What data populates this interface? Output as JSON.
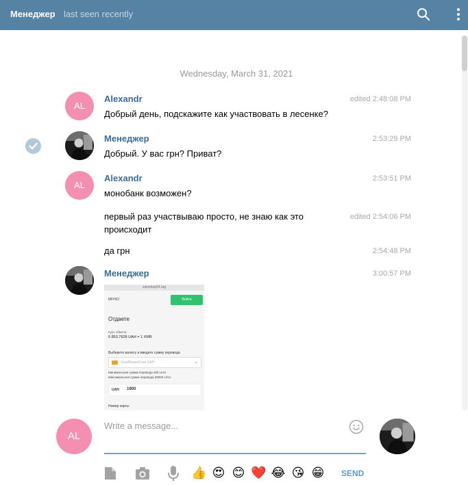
{
  "header": {
    "peer_name": "Менеджер",
    "status": "last seen recently",
    "search_icon": "search-icon",
    "menu_icon": "more-vertical-icon"
  },
  "chat": {
    "date": "Wednesday, March 31, 2021",
    "messages": [
      {
        "author": "Alexandr",
        "initials": "AL",
        "text": "Добрый день, подскажите как участвовать в лесенке?",
        "time": "edited 2:48:08 PM"
      },
      {
        "author": "Менеджер",
        "text": "Добрый. У вас грн? Приват?",
        "time": "2:53:29 PM"
      },
      {
        "author": "Alexandr",
        "initials": "AL",
        "text": "монобанк возможен?",
        "time": "2:53:51 PM"
      },
      {
        "text": "первый раз участвываю просто, не знаю как это происходит",
        "time": "edited 2:54:06 PM"
      },
      {
        "text": "да грн",
        "time": "2:54:48 PM"
      },
      {
        "author": "Менеджер",
        "time": "3:00:57 PM"
      }
    ],
    "screenshot": {
      "url": "coinshop24.org",
      "brand": "MFHIO",
      "login_button": "Войти",
      "heading": "Отдаете",
      "rate_label": "Курс обмена",
      "rate_value": "6 853.7628 UAH = 1 XMR",
      "select_prompt": "Выберите валюту и введите сумму перевода",
      "card_option": "Visa/MasterCard UAH",
      "min_amount": "Минимальная сумма перевода 400 UAH",
      "max_amount": "Максимальная сумма перевода 28000 UAH",
      "currency": "UAH",
      "amount": "1900",
      "card_number_label": "Номер карты"
    }
  },
  "composer": {
    "my_initials": "AL",
    "placeholder": "Write a message...",
    "send_label": "SEND",
    "emoji": [
      "👍",
      "😍",
      "😊",
      "❤️",
      "😂",
      "😘",
      "😁"
    ]
  },
  "colors": {
    "header_bg": "#5682a3",
    "author": "#3a6d99",
    "avatar_bg": "#f48fb1",
    "send": "#5b9bd1"
  }
}
